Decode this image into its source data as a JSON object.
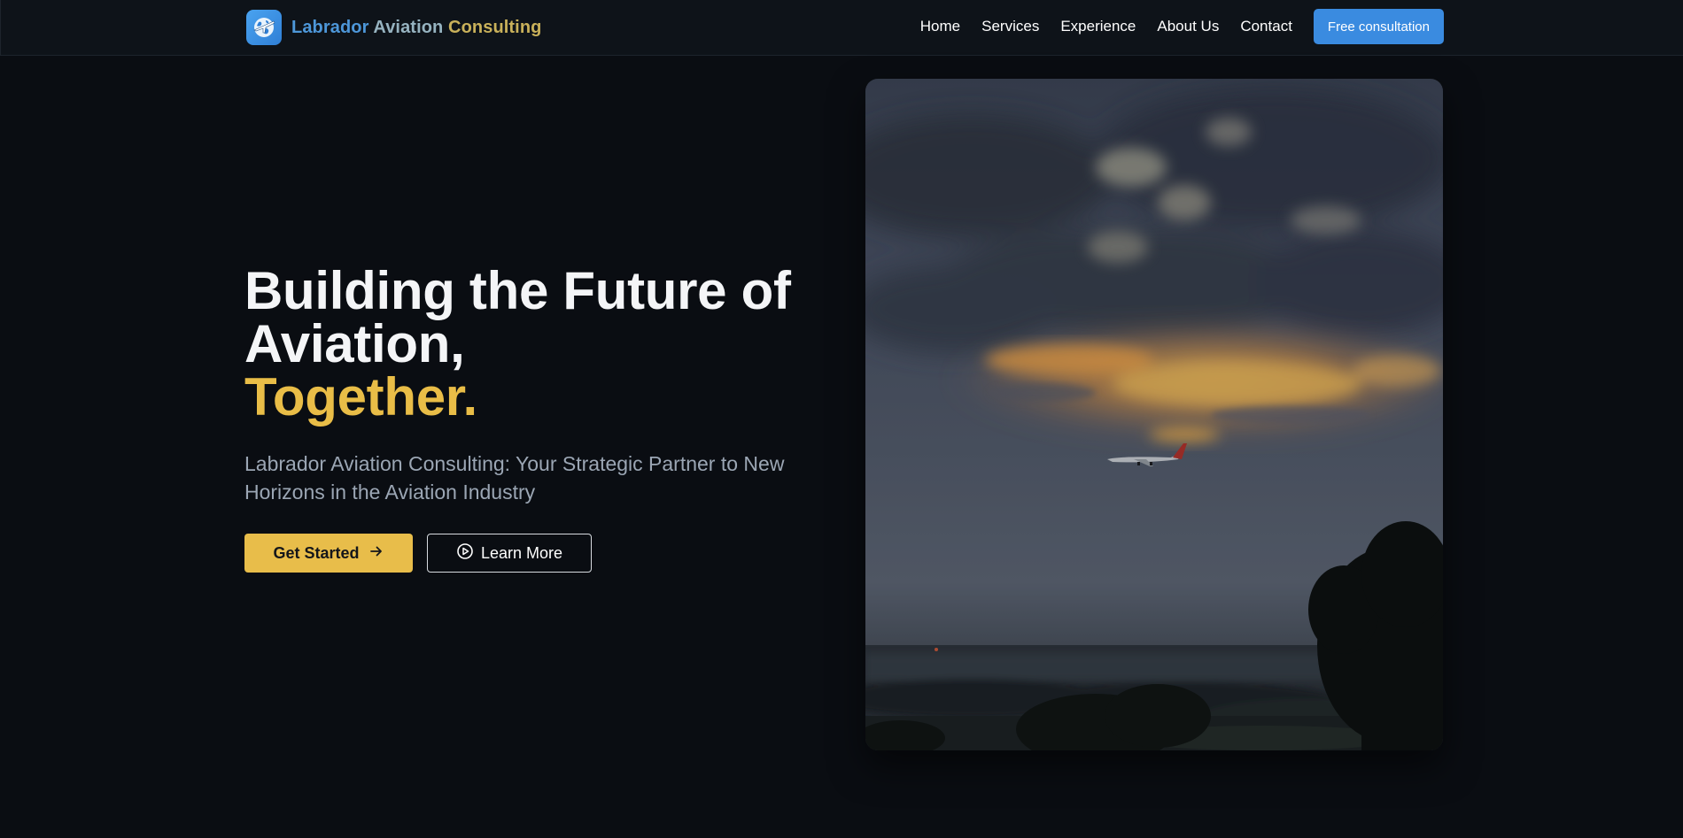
{
  "header": {
    "brand": {
      "word1": "Labrador",
      "word2": "Aviation",
      "word3": "Consulting",
      "logo_icon": "globe-airplane-icon"
    },
    "nav": [
      "Home",
      "Services",
      "Experience",
      "About Us",
      "Contact"
    ],
    "cta_label": "Free consultation"
  },
  "hero": {
    "title_line1": "Building the Future of Aviation,",
    "title_accent": "Together.",
    "subtitle": "Labrador Aviation Consulting: Your Strategic Partner to New Horizons in the Aviation Industry",
    "primary_button": {
      "label": "Get Started",
      "icon": "arrow-right-icon"
    },
    "secondary_button": {
      "label": "Learn More",
      "icon": "play-circle-icon"
    },
    "image_alt": "airplane-in-sunset-sky-photo"
  },
  "colors": {
    "background": "#0a0d12",
    "header_bg": "#0e1319",
    "accent_gold": "#e9bd47",
    "brand_blue": "#3a8be0",
    "subtitle_gray": "#9ba6b4"
  }
}
